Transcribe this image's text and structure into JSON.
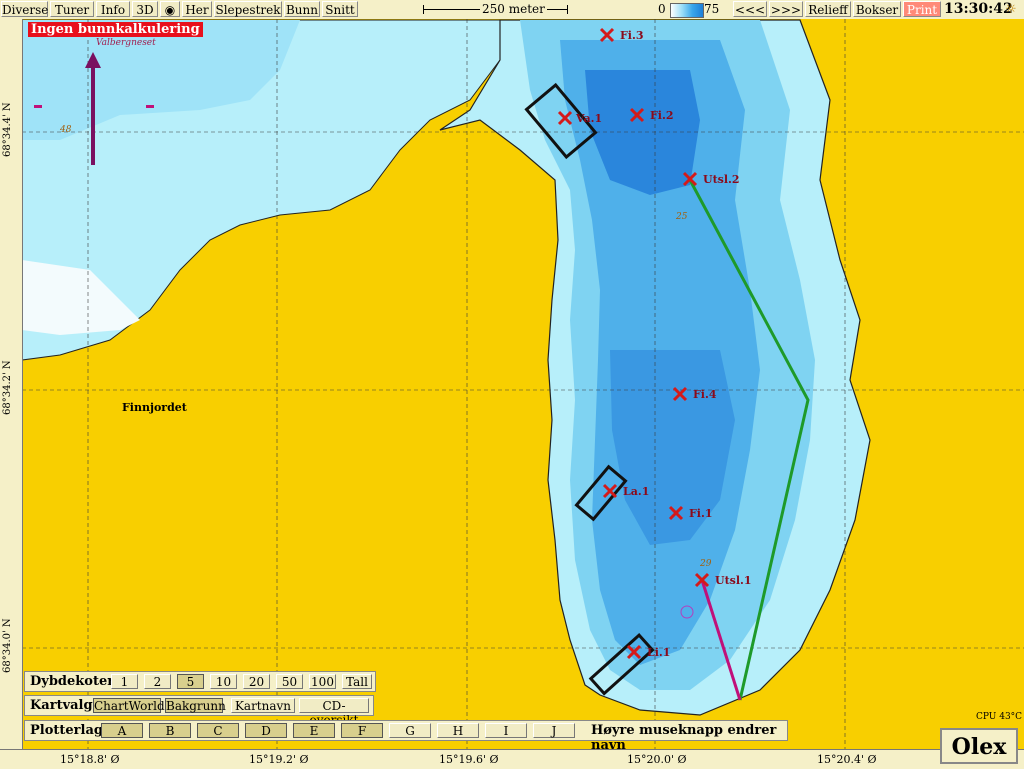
{
  "toolbar": {
    "diverse": "Diverse",
    "turer": "Turer",
    "info": "Info",
    "three_d": "3D",
    "her": "Her",
    "slepestrek": "Slepestrek",
    "bunn": "Bunn",
    "snitt": "Snitt",
    "scale_label": "250 meter",
    "depth_min": "0",
    "depth_max": "75",
    "prev": "<<<",
    "next": ">>>",
    "relieff": "Relieff",
    "bokser": "Bokser",
    "print": "Print",
    "clock": "13:30:42"
  },
  "status_banner": "Ingen bunnkalkulering",
  "map": {
    "place_names": [
      "Valbergneset",
      "Finnjordet"
    ],
    "depth_labels": [
      "48",
      "25",
      "29"
    ],
    "markers": [
      "Fi.3",
      "Va.1",
      "Fi.2",
      "Utsl.2",
      "Fi.4",
      "La.1",
      "Fi.1",
      "Utsl.1",
      "Li.1"
    ],
    "latitudes": [
      "68°34.4' N",
      "68°34.2' N",
      "68°34.0' N"
    ],
    "longitudes": [
      "15°18.8' Ø",
      "15°19.2' Ø",
      "15°19.6' Ø",
      "15°20.0' Ø",
      "15°20.4' Ø"
    ]
  },
  "dybdekoter": {
    "label": "Dybdekoter",
    "options": [
      "1",
      "2",
      "5",
      "10",
      "20",
      "50",
      "100",
      "Tall"
    ],
    "selected": "5"
  },
  "kartvalg": {
    "label": "Kartvalg",
    "options": [
      "ChartWorld",
      "Bakgrunn",
      "Kartnavn",
      "CD-oversikt"
    ]
  },
  "plotterlag": {
    "label": "Plotterlag",
    "options": [
      "A",
      "B",
      "C",
      "D",
      "E",
      "F",
      "G",
      "H",
      "I",
      "J"
    ],
    "hint": "Høyre museknapp endrer navn"
  },
  "cpu": "CPU 43°C",
  "brand": "Olex",
  "colors": {
    "land": "#f8cf00",
    "shallow": "#b7effa",
    "deep": "#2a86dc",
    "marker": "#d41a1a",
    "track": "#1e9a2a",
    "banner": "#e8101c"
  }
}
